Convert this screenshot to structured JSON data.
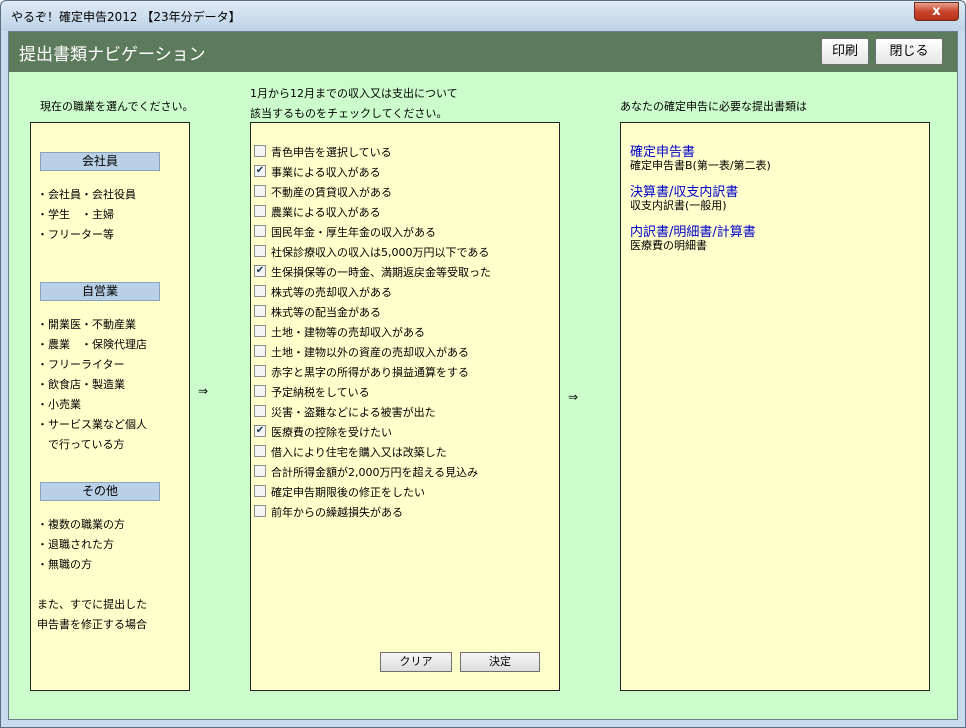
{
  "window": {
    "title": "やるぞ！確定申告2012 【23年分データ】",
    "close_glyph": "x"
  },
  "header": {
    "title": "提出書類ナビゲーション",
    "print_label": "印刷",
    "close_label": "閉じる"
  },
  "left": {
    "heading": "現在の職業を選んでください。",
    "groups": [
      {
        "button": "会社員",
        "items": [
          "・会社員・会社役員",
          "・学生　・主婦",
          "・フリーター等"
        ]
      },
      {
        "button": "自営業",
        "items": [
          "・開業医・不動産業",
          "・農業　・保険代理店",
          "・フリーライター",
          "・飲食店・製造業",
          "・小売業",
          "・サービス業など個人",
          "　で行っている方"
        ]
      },
      {
        "button": "その他",
        "items": [
          "・複数の職業の方",
          "・退職された方",
          "・無職の方"
        ]
      }
    ],
    "note": [
      "また、すでに提出した",
      "申告書を修正する場合"
    ]
  },
  "middle": {
    "heading": [
      "1月から12月までの収入又は支出について",
      "該当するものをチェックしてください。"
    ],
    "checks": [
      {
        "label": "青色申告を選択している",
        "checked": false
      },
      {
        "label": "事業による収入がある",
        "checked": true
      },
      {
        "label": "不動産の賃貸収入がある",
        "checked": false
      },
      {
        "label": "農業による収入がある",
        "checked": false
      },
      {
        "label": "国民年金・厚生年金の収入がある",
        "checked": false
      },
      {
        "label": "社保診療収入の収入は5,000万円以下である",
        "checked": false
      },
      {
        "label": "生保損保等の一時金、満期返戻金等受取った",
        "checked": true
      },
      {
        "label": "株式等の売却収入がある",
        "checked": false
      },
      {
        "label": "株式等の配当金がある",
        "checked": false
      },
      {
        "label": "土地・建物等の売却収入がある",
        "checked": false
      },
      {
        "label": "土地・建物以外の資産の売却収入がある",
        "checked": false
      },
      {
        "label": "赤字と黒字の所得があり損益通算をする",
        "checked": false
      },
      {
        "label": "予定納税をしている",
        "checked": false
      },
      {
        "label": "災害・盗難などによる被害が出た",
        "checked": false
      },
      {
        "label": "医療費の控除を受けたい",
        "checked": true
      },
      {
        "label": "借入により住宅を購入又は改築した",
        "checked": false
      },
      {
        "label": "合計所得金額が2,000万円を超える見込み",
        "checked": false
      },
      {
        "label": "確定申告期限後の修正をしたい",
        "checked": false
      },
      {
        "label": "前年からの繰越損失がある",
        "checked": false
      }
    ],
    "clear_label": "クリア",
    "decide_label": "決定",
    "check_glyph": "✔"
  },
  "right": {
    "heading": "あなたの確定申告に必要な提出書類は",
    "docs": [
      {
        "title": "確定申告書",
        "sub": "確定申告書B(第一表/第二表)"
      },
      {
        "title": "決算書/収支内訳書",
        "sub": "収支内訳書(一般用)"
      },
      {
        "title": "内訳書/明細書/計算書",
        "sub": "医療費の明細書"
      }
    ]
  },
  "arrow": "⇒",
  "colors": {
    "header": "#5c7a5c",
    "client": "#ccfccc",
    "panel": "#ffffcc",
    "link": "#0000cc"
  }
}
